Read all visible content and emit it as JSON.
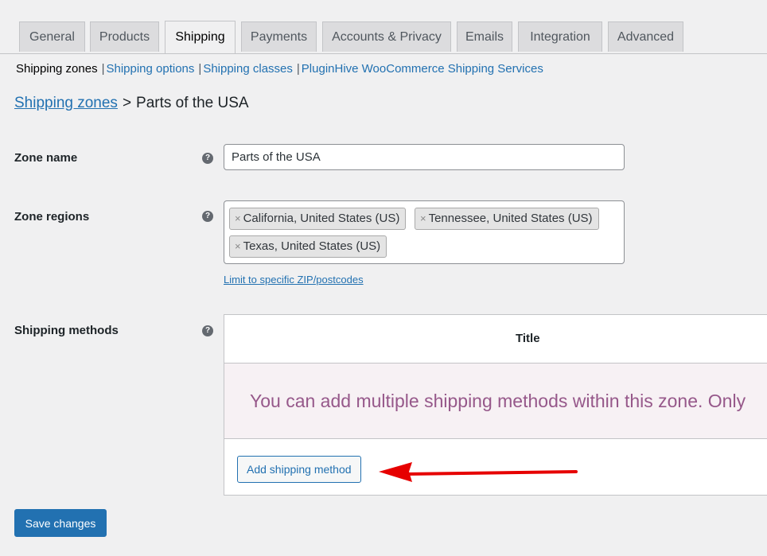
{
  "tabs": [
    {
      "label": "General",
      "active": false
    },
    {
      "label": "Products",
      "active": false
    },
    {
      "label": "Shipping",
      "active": true
    },
    {
      "label": "Payments",
      "active": false
    },
    {
      "label": "Accounts & Privacy",
      "active": false
    },
    {
      "label": "Emails",
      "active": false
    },
    {
      "label": "Integration",
      "active": false
    },
    {
      "label": "Advanced",
      "active": false
    }
  ],
  "subnav": {
    "current": "Shipping zones",
    "separator": "|",
    "links": [
      "Shipping options",
      "Shipping classes",
      "PluginHive WooCommerce Shipping Services"
    ]
  },
  "breadcrumb": {
    "link": "Shipping zones",
    "separator": ">",
    "current": "Parts of the USA"
  },
  "form": {
    "help_glyph": "?",
    "zone_name_label": "Zone name",
    "zone_name_value": "Parts of the USA",
    "zone_regions_label": "Zone regions",
    "region_remove_glyph": "×",
    "regions": [
      "California, United States (US)",
      "Tennessee, United States (US)",
      "Texas, United States (US)"
    ],
    "zip_link": "Limit to specific ZIP/postcodes",
    "shipping_methods_label": "Shipping methods",
    "methods_table_title": "Title",
    "methods_blank_message": "You can add multiple shipping methods within this zone. Only",
    "add_method_button": "Add shipping method"
  },
  "save_button": "Save changes",
  "colors": {
    "accent": "#2271b1",
    "blank_state_text": "#96588a",
    "annotation_arrow": "#e60000"
  },
  "annotation": {
    "arrow_icon": "red-arrow-left"
  }
}
